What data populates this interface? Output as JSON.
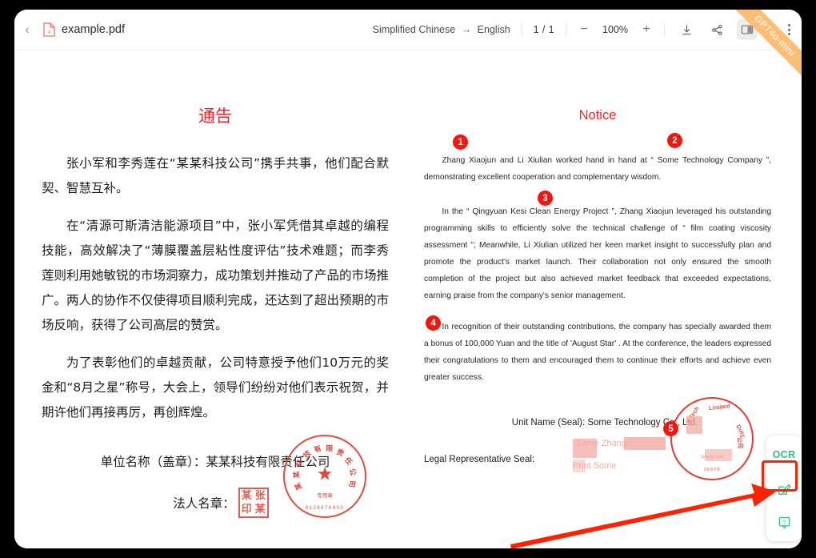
{
  "header": {
    "back_label": "‹",
    "file_name": "example.pdf",
    "pdf_icon": "pdf-file-icon",
    "source_language": "Simplified Chinese",
    "arrow": "→",
    "target_language": "English",
    "page_indicator": "1 / 1",
    "zoom_out": "−",
    "zoom_value": "100%",
    "zoom_in": "+",
    "download_icon": "download-icon",
    "share_icon": "share-icon",
    "split_view_icon": "split-view-icon",
    "more_icon": "more-vertical-icon"
  },
  "ribbon": {
    "label": "GPT4o-mini"
  },
  "left_pane": {
    "title": "通告",
    "paragraphs": [
      "张小军和李秀莲在“某某科技公司”携手共事，他们配合默契、智慧互补。",
      "在“清源可斯清洁能源项目”中，张小军凭借其卓越的编程技能，高效解决了“薄膜覆盖层粘性度评估”技术难题；而李秀莲则利用她敏锐的市场洞察力，成功策划并推动了产品的市场推广。两人的协作不仅使得项目顺利完成，还达到了超出预期的市场反响，获得了公司高层的赞赏。",
      "为了表彰他们的卓越贡献，公司特意授予他们10万元的奖金和“8月之星”称号，大会上，领导们纷纷对他们表示祝贺，并期许他们再接再厉，再创辉煌。"
    ],
    "unit_name_line": "单位名称（盖章）：某某科技有限责任公司",
    "legal_rep_line": "法人名章：",
    "company_seal": {
      "ring_text": "某某科技有限责任公司",
      "sub_text": "专用章",
      "number": "0126678900",
      "star": "★"
    },
    "personal_seal_chars": [
      "某",
      "张",
      "印",
      "某"
    ]
  },
  "right_pane": {
    "title": "Notice",
    "paragraphs": [
      "Zhang Xiaojun and Li Xiulian worked hand in hand at “ Some Technology Company ”, demonstrating excellent cooperation and complementary wisdom.",
      "In the “ Qingyuan Kesi Clean Energy Project ”, Zhang Xiaojun leveraged his outstanding programming skills to efficiently solve the technical challenge of “ film coating viscosity assessment ”; Meanwhile, Li Xiulian utilized her keen market insight to successfully plan and promote the product's market launch. Their collaboration not only ensured the smooth completion of the project but also achieved market feedback that exceeded expectations, earning praise from the company's senior management.",
      "In recognition of their outstanding contributions, the company has specially awarded them a bonus of 100,000 Yuan and the title of 'August Star' . At the conference, the leaders expressed their congratulations to them and encouraged them to continue their efforts and achieve even greater success."
    ],
    "unit_name_line": "Unit Name (Seal): Some Technology Co., Ltd.",
    "legal_rep_line": "Legal Representative Seal:",
    "company_seal": {
      "ring_words": [
        "X Tech",
        "Limited",
        "Duty",
        "公司"
      ],
      "sub_text": "Special Seal",
      "number": "26678"
    },
    "ghost_text": [
      "Some Zhang",
      "Print Some"
    ],
    "badges": [
      "1",
      "2",
      "3",
      "4",
      "5"
    ]
  },
  "side_tools": {
    "ocr_label": "OCR",
    "edit_icon": "edit-pencil-icon",
    "help_icon": "help-question-icon"
  },
  "colors": {
    "accent_red": "#f5222d",
    "badge_red": "#f5150d",
    "ribbon_orange": "#fcbe77",
    "tool_green": "#2fc27a",
    "annotation_red": "#ff2200"
  }
}
